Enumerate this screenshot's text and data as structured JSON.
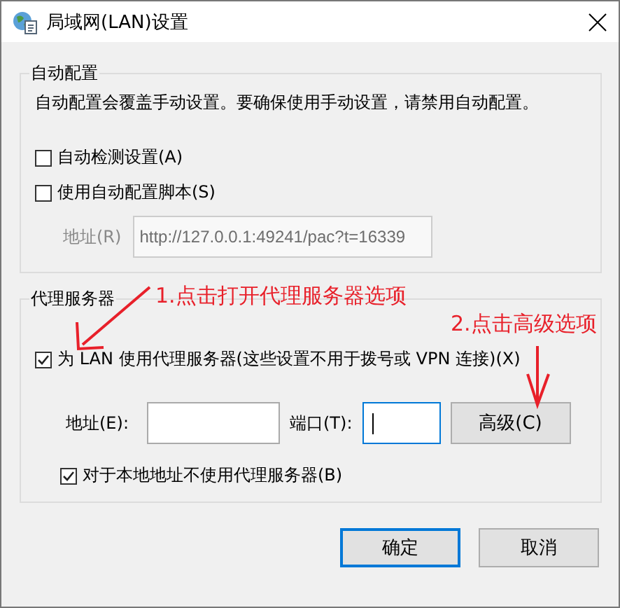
{
  "window": {
    "title": "局域网(LAN)设置"
  },
  "auto_config": {
    "legend": "自动配置",
    "description": "自动配置会覆盖手动设置。要确保使用手动设置，请禁用自动配置。",
    "options": [
      {
        "label": "自动检测设置(A)",
        "checked": false
      },
      {
        "label": "使用自动配置脚本(S)",
        "checked": false
      }
    ],
    "address": {
      "label": "地址(R)",
      "value": "http://127.0.0.1:49241/pac?t=16339",
      "disabled": true
    }
  },
  "proxy": {
    "legend": "代理服务器",
    "use_proxy": {
      "label": "为 LAN 使用代理服务器(这些设置不用于拨号或 VPN 连接)(X)",
      "checked": true
    },
    "address": {
      "label": "地址(E):"
    },
    "port": {
      "label": "端口(T):",
      "focused": true
    },
    "advanced_button": "高级(C)",
    "bypass_local": {
      "label": "对于本地地址不使用代理服务器(B)",
      "checked": true
    }
  },
  "buttons": [
    {
      "label": "确定",
      "default": true
    },
    {
      "label": "取消",
      "default": false
    }
  ],
  "annotations": [
    {
      "text": "1.点击打开代理服务器选项"
    },
    {
      "text": "2.点击高级选项"
    }
  ]
}
